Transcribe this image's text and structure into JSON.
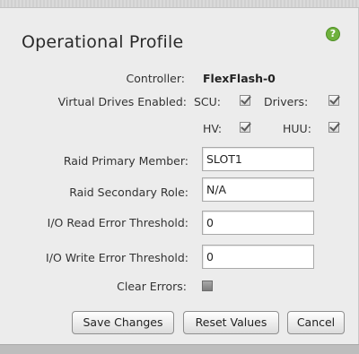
{
  "dialog": {
    "title": "Operational Profile",
    "help_icon": "question-mark-icon",
    "help_glyph": "?"
  },
  "controller": {
    "label": "Controller:",
    "value": "FlexFlash-0"
  },
  "virtual_drives": {
    "label": "Virtual Drives Enabled:",
    "items": [
      {
        "label": "SCU:",
        "checked": true
      },
      {
        "label": "Drivers:",
        "checked": true
      },
      {
        "label": "HV:",
        "checked": true
      },
      {
        "label": "HUU:",
        "checked": true
      }
    ]
  },
  "fields": {
    "raid_primary_member": {
      "label": "Raid Primary Member:",
      "value": "SLOT1"
    },
    "raid_secondary_role": {
      "label": "Raid Secondary Role:",
      "value": "N/A"
    },
    "io_read_error_threshold": {
      "label": "I/O Read Error Threshold:",
      "value": "0"
    },
    "io_write_error_threshold": {
      "label": "I/O Write Error Threshold:",
      "value": "0"
    }
  },
  "clear_errors": {
    "label": "Clear Errors:",
    "checked": false
  },
  "buttons": {
    "save": "Save Changes",
    "reset": "Reset Values",
    "cancel": "Cancel"
  }
}
